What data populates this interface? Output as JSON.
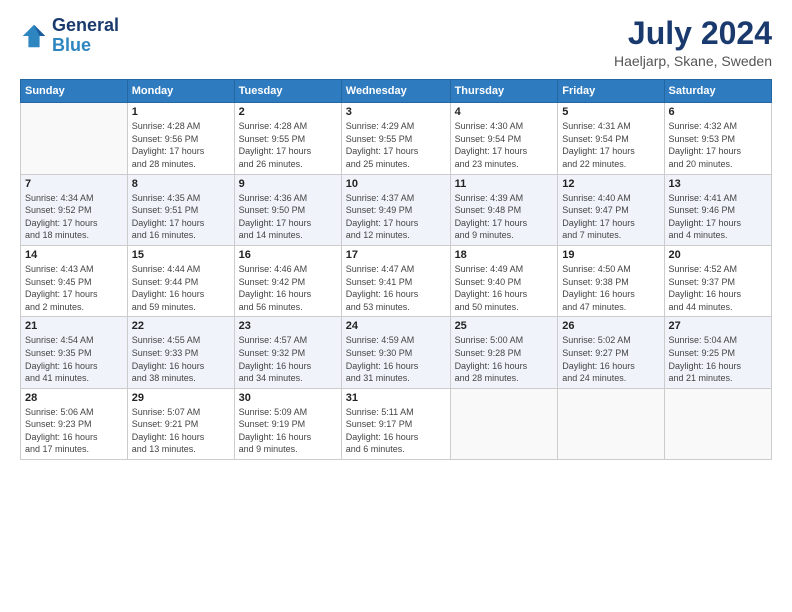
{
  "logo": {
    "line1": "General",
    "line2": "Blue"
  },
  "title": "July 2024",
  "location": "Haeljarp, Skane, Sweden",
  "headers": [
    "Sunday",
    "Monday",
    "Tuesday",
    "Wednesday",
    "Thursday",
    "Friday",
    "Saturday"
  ],
  "weeks": [
    [
      {
        "day": "",
        "info": ""
      },
      {
        "day": "1",
        "info": "Sunrise: 4:28 AM\nSunset: 9:56 PM\nDaylight: 17 hours\nand 28 minutes."
      },
      {
        "day": "2",
        "info": "Sunrise: 4:28 AM\nSunset: 9:55 PM\nDaylight: 17 hours\nand 26 minutes."
      },
      {
        "day": "3",
        "info": "Sunrise: 4:29 AM\nSunset: 9:55 PM\nDaylight: 17 hours\nand 25 minutes."
      },
      {
        "day": "4",
        "info": "Sunrise: 4:30 AM\nSunset: 9:54 PM\nDaylight: 17 hours\nand 23 minutes."
      },
      {
        "day": "5",
        "info": "Sunrise: 4:31 AM\nSunset: 9:54 PM\nDaylight: 17 hours\nand 22 minutes."
      },
      {
        "day": "6",
        "info": "Sunrise: 4:32 AM\nSunset: 9:53 PM\nDaylight: 17 hours\nand 20 minutes."
      }
    ],
    [
      {
        "day": "7",
        "info": "Sunrise: 4:34 AM\nSunset: 9:52 PM\nDaylight: 17 hours\nand 18 minutes."
      },
      {
        "day": "8",
        "info": "Sunrise: 4:35 AM\nSunset: 9:51 PM\nDaylight: 17 hours\nand 16 minutes."
      },
      {
        "day": "9",
        "info": "Sunrise: 4:36 AM\nSunset: 9:50 PM\nDaylight: 17 hours\nand 14 minutes."
      },
      {
        "day": "10",
        "info": "Sunrise: 4:37 AM\nSunset: 9:49 PM\nDaylight: 17 hours\nand 12 minutes."
      },
      {
        "day": "11",
        "info": "Sunrise: 4:39 AM\nSunset: 9:48 PM\nDaylight: 17 hours\nand 9 minutes."
      },
      {
        "day": "12",
        "info": "Sunrise: 4:40 AM\nSunset: 9:47 PM\nDaylight: 17 hours\nand 7 minutes."
      },
      {
        "day": "13",
        "info": "Sunrise: 4:41 AM\nSunset: 9:46 PM\nDaylight: 17 hours\nand 4 minutes."
      }
    ],
    [
      {
        "day": "14",
        "info": "Sunrise: 4:43 AM\nSunset: 9:45 PM\nDaylight: 17 hours\nand 2 minutes."
      },
      {
        "day": "15",
        "info": "Sunrise: 4:44 AM\nSunset: 9:44 PM\nDaylight: 16 hours\nand 59 minutes."
      },
      {
        "day": "16",
        "info": "Sunrise: 4:46 AM\nSunset: 9:42 PM\nDaylight: 16 hours\nand 56 minutes."
      },
      {
        "day": "17",
        "info": "Sunrise: 4:47 AM\nSunset: 9:41 PM\nDaylight: 16 hours\nand 53 minutes."
      },
      {
        "day": "18",
        "info": "Sunrise: 4:49 AM\nSunset: 9:40 PM\nDaylight: 16 hours\nand 50 minutes."
      },
      {
        "day": "19",
        "info": "Sunrise: 4:50 AM\nSunset: 9:38 PM\nDaylight: 16 hours\nand 47 minutes."
      },
      {
        "day": "20",
        "info": "Sunrise: 4:52 AM\nSunset: 9:37 PM\nDaylight: 16 hours\nand 44 minutes."
      }
    ],
    [
      {
        "day": "21",
        "info": "Sunrise: 4:54 AM\nSunset: 9:35 PM\nDaylight: 16 hours\nand 41 minutes."
      },
      {
        "day": "22",
        "info": "Sunrise: 4:55 AM\nSunset: 9:33 PM\nDaylight: 16 hours\nand 38 minutes."
      },
      {
        "day": "23",
        "info": "Sunrise: 4:57 AM\nSunset: 9:32 PM\nDaylight: 16 hours\nand 34 minutes."
      },
      {
        "day": "24",
        "info": "Sunrise: 4:59 AM\nSunset: 9:30 PM\nDaylight: 16 hours\nand 31 minutes."
      },
      {
        "day": "25",
        "info": "Sunrise: 5:00 AM\nSunset: 9:28 PM\nDaylight: 16 hours\nand 28 minutes."
      },
      {
        "day": "26",
        "info": "Sunrise: 5:02 AM\nSunset: 9:27 PM\nDaylight: 16 hours\nand 24 minutes."
      },
      {
        "day": "27",
        "info": "Sunrise: 5:04 AM\nSunset: 9:25 PM\nDaylight: 16 hours\nand 21 minutes."
      }
    ],
    [
      {
        "day": "28",
        "info": "Sunrise: 5:06 AM\nSunset: 9:23 PM\nDaylight: 16 hours\nand 17 minutes."
      },
      {
        "day": "29",
        "info": "Sunrise: 5:07 AM\nSunset: 9:21 PM\nDaylight: 16 hours\nand 13 minutes."
      },
      {
        "day": "30",
        "info": "Sunrise: 5:09 AM\nSunset: 9:19 PM\nDaylight: 16 hours\nand 9 minutes."
      },
      {
        "day": "31",
        "info": "Sunrise: 5:11 AM\nSunset: 9:17 PM\nDaylight: 16 hours\nand 6 minutes."
      },
      {
        "day": "",
        "info": ""
      },
      {
        "day": "",
        "info": ""
      },
      {
        "day": "",
        "info": ""
      }
    ]
  ]
}
